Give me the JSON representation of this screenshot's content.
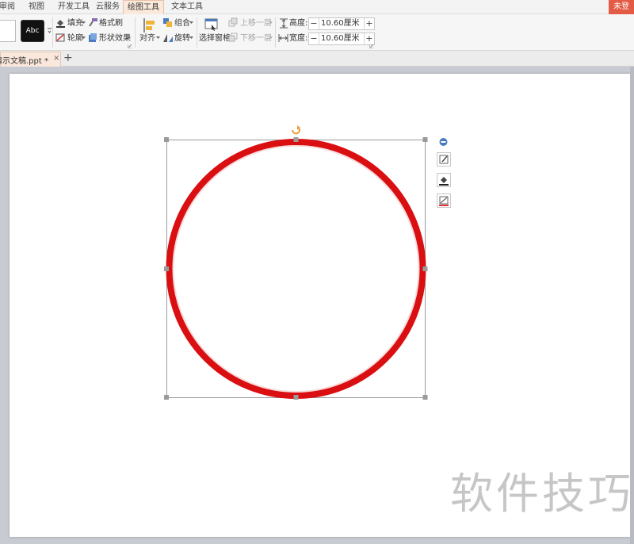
{
  "menu": {
    "tabs": [
      {
        "label": "审阅",
        "active": false
      },
      {
        "label": "视图",
        "active": false
      },
      {
        "label": "开发工具",
        "active": false
      },
      {
        "label": "云服务",
        "active": false
      },
      {
        "label": "绘图工具",
        "active": true
      },
      {
        "label": "文本工具",
        "active": false
      }
    ],
    "login_label": "未登"
  },
  "ribbon": {
    "style_preset_label": "Abc",
    "fill_label": "填充",
    "format_painter_label": "格式刷",
    "outline_label": "轮廓",
    "shape_effects_label": "形状效果",
    "align_label": "对齐",
    "group_label": "组合",
    "rotate_label": "旋转",
    "selection_pane_label": "选择窗格",
    "bring_forward_label": "上移一层",
    "send_backward_label": "下移一层",
    "height_label": "高度:",
    "height_value": "10.60厘米",
    "width_label": "宽度:",
    "width_value": "10.60厘米",
    "minus_symbol": "−",
    "plus_symbol": "+"
  },
  "document": {
    "tab_label": "演示文稿.ppt *",
    "close_symbol": "×",
    "new_tab_symbol": "+"
  },
  "shape": {
    "type": "circle",
    "stroke_color": "#d90f12",
    "selected": true
  },
  "colors": {
    "accent_tab": "#fbe9dc",
    "login": "#e35b44",
    "rotate_handle": "#e8a23c",
    "handle": "#9a9a9a"
  },
  "watermark": "软件技巧"
}
